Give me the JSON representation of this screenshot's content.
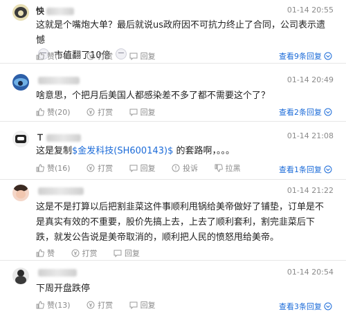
{
  "comments": [
    {
      "user_name": "怏",
      "time": "01-14 20:55",
      "text_before_emoji": "这就是个嘴炮大单？最后就说us政府因不可抗力终止了合同，公司表示遗憾",
      "text_after_emoji": "市值翻了10倍",
      "like": "赞(64)",
      "tip": "打赏",
      "reply": "回复",
      "more_replies": "查看9条回复"
    },
    {
      "user_name": "",
      "time": "01-14 20:49",
      "text": "啥意思，个把月后美国人都感染差不多了都不需要这个了？",
      "like": "赞(20)",
      "tip": "打赏",
      "reply": "回复",
      "more_replies": "查看2条回复"
    },
    {
      "user_name": "Ｔ",
      "time": "01-14 21:08",
      "text_pre": "这是复制",
      "stock_link": "$金发科技(SH600143)$",
      "text_post": " 的套路啊，。。。",
      "like": "赞(16)",
      "tip": "打赏",
      "reply": "回复",
      "report": "投诉",
      "dislike": "拉黑",
      "more_replies": "查看1条回复"
    },
    {
      "user_name": "",
      "time": "01-14 21:22",
      "text": "这是不是打算以后把割韭菜这件事顺利甩锅给美帝做好了铺垫，订单是不是真实有效的不重要，股价先搞上去，上去了顺利套利，割完韭菜后下跌，就发公告说是美帝取消的，顺利把人民的愤怒甩给美帝。",
      "like": "赞",
      "tip": "打赏",
      "reply": "回复"
    },
    {
      "user_name": "",
      "time": "01-14 20:54",
      "text": "下周开盘跌停",
      "like": "赞(13)",
      "tip": "打赏",
      "reply": "回复",
      "more_replies": "查看3条回复"
    }
  ],
  "colors": {
    "link": "#1a6ad8",
    "meta": "#8a8a8a"
  }
}
